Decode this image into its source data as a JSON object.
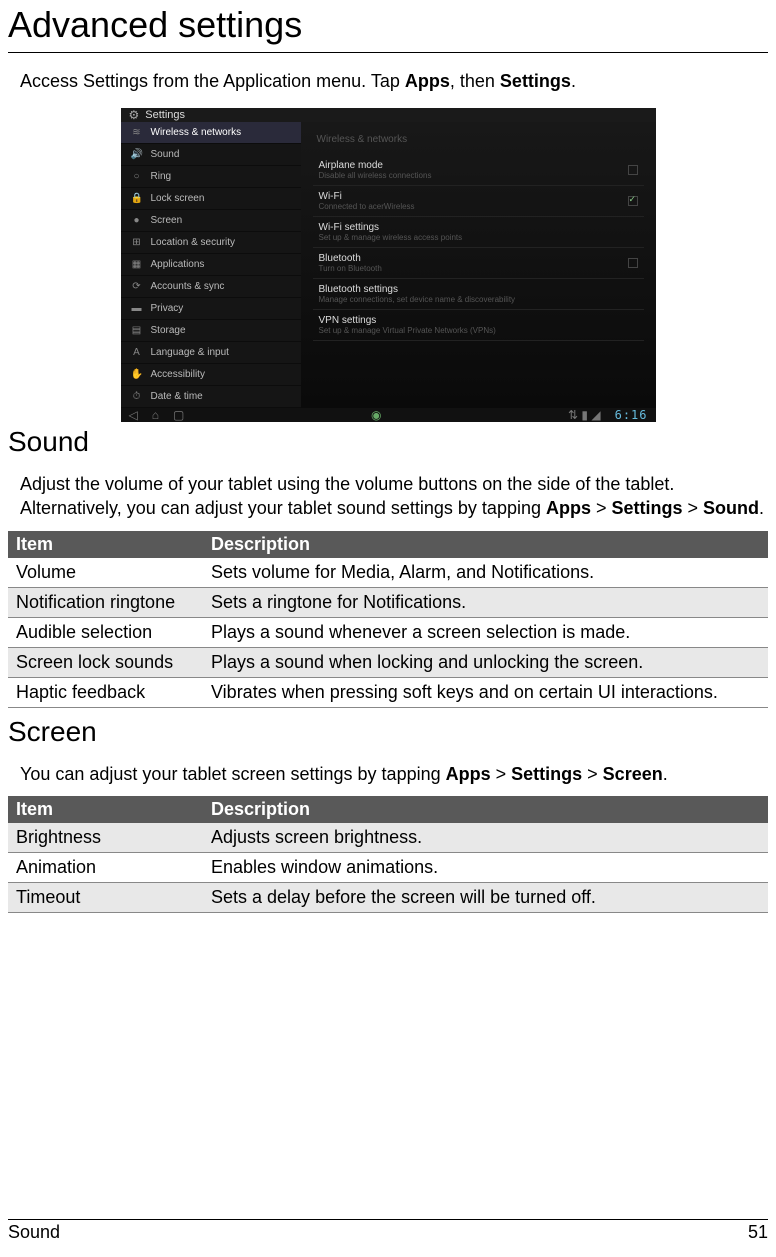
{
  "page_title": "Advanced settings",
  "intro": {
    "prefix": "Access Settings from the Application menu. Tap ",
    "apps": "Apps",
    "mid": ", then ",
    "settings": "Settings",
    "suffix": "."
  },
  "screenshot": {
    "header_title": "Settings",
    "left": [
      {
        "icon": "≋",
        "label": "Wireless & networks",
        "selected": true
      },
      {
        "icon": "🔊",
        "label": "Sound"
      },
      {
        "icon": "○",
        "label": "Ring"
      },
      {
        "icon": "🔒",
        "label": "Lock screen"
      },
      {
        "icon": "●",
        "label": "Screen"
      },
      {
        "icon": "⊞",
        "label": "Location & security"
      },
      {
        "icon": "▦",
        "label": "Applications"
      },
      {
        "icon": "⟳",
        "label": "Accounts & sync"
      },
      {
        "icon": "▬",
        "label": "Privacy"
      },
      {
        "icon": "▤",
        "label": "Storage"
      },
      {
        "icon": "A",
        "label": "Language & input"
      },
      {
        "icon": "✋",
        "label": "Accessibility"
      },
      {
        "icon": "⏱",
        "label": "Date & time"
      }
    ],
    "right_header": "Wireless & networks",
    "right": [
      {
        "t1": "Airplane mode",
        "t2": "Disable all wireless connections",
        "check": "off"
      },
      {
        "t1": "Wi-Fi",
        "t2": "Connected to acerWireless",
        "check": "on"
      },
      {
        "t1": "Wi-Fi settings",
        "t2": "Set up & manage wireless access points"
      },
      {
        "t1": "Bluetooth",
        "t2": "Turn on Bluetooth",
        "check": "off"
      },
      {
        "t1": "Bluetooth settings",
        "t2": "Manage connections, set device name & discoverability"
      },
      {
        "t1": "VPN settings",
        "t2": "Set up & manage Virtual Private Networks (VPNs)"
      }
    ],
    "clock": "6:16"
  },
  "sound": {
    "heading": "Sound",
    "intro_prefix": "Adjust the volume of your tablet using the volume buttons on the side of the tablet. Alternatively, you can adjust your tablet sound settings by tapping ",
    "apps": "Apps",
    "gt1": " > ",
    "settings": "Settings",
    "gt2": " > ",
    "sound": "Sound",
    "suffix": ".",
    "th1": "Item",
    "th2": "Description",
    "rows": [
      {
        "item": "Volume",
        "desc": "Sets volume for Media, Alarm, and Notifications."
      },
      {
        "item": "Notification ringtone",
        "desc": "Sets a ringtone for Notifications."
      },
      {
        "item": "Audible selection",
        "desc": "Plays a sound whenever a screen selection is made."
      },
      {
        "item": "Screen lock sounds",
        "desc": "Plays a sound when locking and unlocking the screen."
      },
      {
        "item": "Haptic feedback",
        "desc": "Vibrates when pressing soft keys and on certain UI interactions."
      }
    ]
  },
  "screen": {
    "heading": "Screen",
    "intro_prefix": "You can adjust your tablet screen settings by tapping ",
    "apps": "Apps",
    "gt1": " > ",
    "settings": "Settings",
    "gt2": " > ",
    "screen": "Screen",
    "suffix": ".",
    "th1": "Item",
    "th2": "Description",
    "rows": [
      {
        "item": "Brightness",
        "desc": "Adjusts screen brightness."
      },
      {
        "item": "Animation",
        "desc": "Enables window animations."
      },
      {
        "item": "Timeout",
        "desc": "Sets a delay before the screen will be turned off."
      }
    ]
  },
  "footer": {
    "left": "Sound",
    "right": "51"
  }
}
